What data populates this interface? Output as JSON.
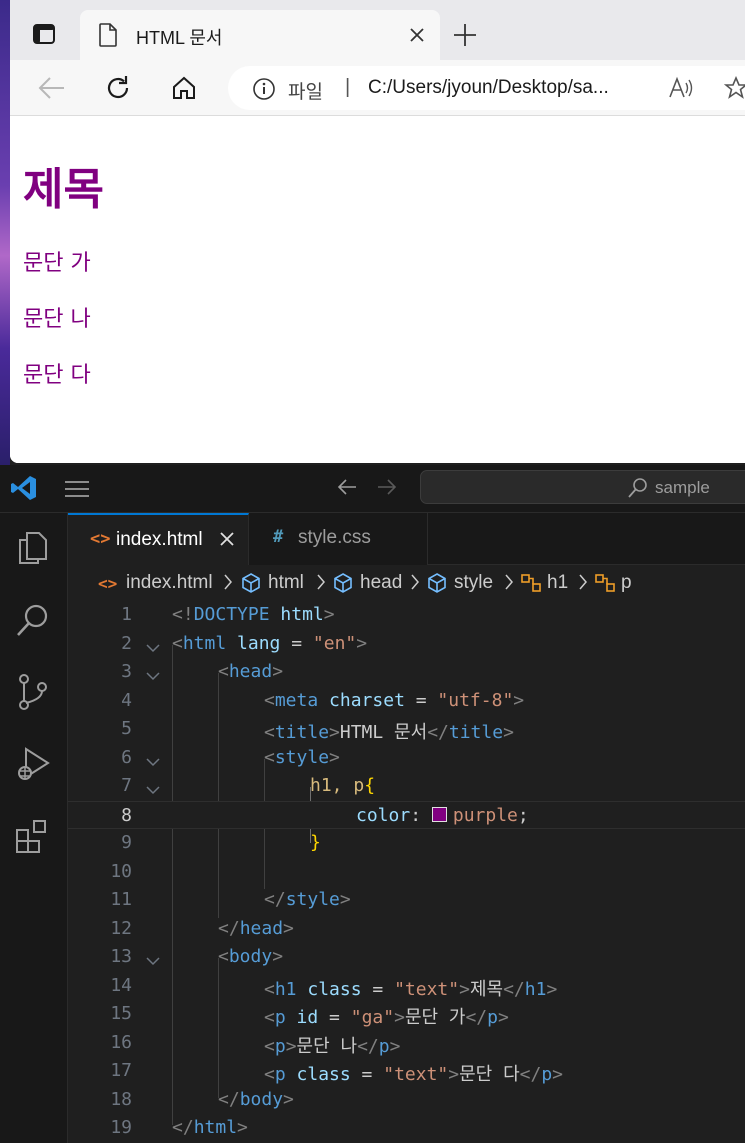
{
  "browser": {
    "tab_title": "HTML 문서",
    "address_scheme": "파일",
    "address_url": "C:/Users/jyoun/Desktop/sa...",
    "page": {
      "heading": "제목",
      "paragraphs": [
        "문단 가",
        "문단 나",
        "문단 다"
      ]
    }
  },
  "vscode": {
    "command_center_label": "sample",
    "tabs": [
      {
        "icon": "<>",
        "label": "index.html",
        "active": true
      },
      {
        "icon": "#",
        "label": "style.css",
        "active": false
      }
    ],
    "breadcrumb": {
      "file_icon": "<>",
      "items": [
        "index.html",
        "html",
        "head",
        "style",
        "h1",
        "p"
      ]
    },
    "line_numbers": [
      "1",
      "2",
      "3",
      "4",
      "5",
      "6",
      "7",
      "8",
      "9",
      "10",
      "11",
      "12",
      "13",
      "14",
      "15",
      "16",
      "17",
      "18",
      "19"
    ],
    "current_line": 8,
    "code": {
      "l1": {
        "open": "<!",
        "kw": "DOCTYPE",
        "sp": " ",
        "tag": "html",
        "close": ">"
      },
      "l2": {
        "lt": "<",
        "tag": "html",
        "sp": " ",
        "attr": "lang",
        "eq": " = ",
        "val": "\"en\"",
        "gt": ">"
      },
      "l3": {
        "lt": "<",
        "tag": "head",
        "gt": ">"
      },
      "l4": {
        "lt": "<",
        "tag": "meta",
        "sp": " ",
        "attr": "charset",
        "eq": " = ",
        "val": "\"utf-8\"",
        "gt": ">"
      },
      "l5": {
        "lt": "<",
        "tag": "title",
        "gt": ">",
        "text": "HTML 문서",
        "lt2": "</",
        "tag2": "title",
        "gt2": ">"
      },
      "l6": {
        "lt": "<",
        "tag": "style",
        "gt": ">"
      },
      "l7": {
        "sel": "h1, p",
        "brace": "{"
      },
      "l8": {
        "prop": "color",
        "colon": ": ",
        "value": "purple",
        "semi": ";"
      },
      "l9": {
        "brace": "}"
      },
      "l11": {
        "lt": "</",
        "tag": "style",
        "gt": ">"
      },
      "l12": {
        "lt": "</",
        "tag": "head",
        "gt": ">"
      },
      "l13": {
        "lt": "<",
        "tag": "body",
        "gt": ">"
      },
      "l14": {
        "lt": "<",
        "tag": "h1",
        "sp": " ",
        "attr": "class",
        "eq": " = ",
        "val": "\"text\"",
        "gt": ">",
        "text": "제목",
        "lt2": "</",
        "tag2": "h1",
        "gt2": ">"
      },
      "l15": {
        "lt": "<",
        "tag": "p",
        "sp": " ",
        "attr": "id",
        "eq": " = ",
        "val": "\"ga\"",
        "gt": ">",
        "text": "문단 가",
        "lt2": "</",
        "tag2": "p",
        "gt2": ">"
      },
      "l16": {
        "lt": "<",
        "tag": "p",
        "gt": ">",
        "text": "문단 나",
        "lt2": "</",
        "tag2": "p",
        "gt2": ">"
      },
      "l17": {
        "lt": "<",
        "tag": "p",
        "sp": " ",
        "attr": "class",
        "eq": " = ",
        "val": "\"text\"",
        "gt": ">",
        "text": "문단 다",
        "lt2": "</",
        "tag2": "p",
        "gt2": ">"
      },
      "l18": {
        "lt": "</",
        "tag": "body",
        "gt": ">"
      },
      "l19": {
        "lt": "</",
        "tag": "html",
        "gt": ">"
      }
    }
  },
  "colors": {
    "page_text": "#800080",
    "vscode_accent": "#0078d4",
    "html_icon": "#e37933",
    "css_icon": "#519aba"
  }
}
